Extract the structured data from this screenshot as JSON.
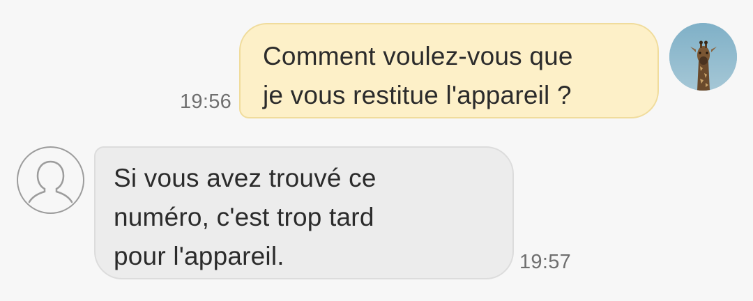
{
  "conversation": {
    "messages": [
      {
        "direction": "outgoing",
        "text": "Comment voulez-vous que\nje vous restitue l'appareil ?",
        "time": "19:56",
        "avatar_icon": "giraffe-photo-avatar"
      },
      {
        "direction": "incoming",
        "text": "Si vous avez trouvé ce\nnuméro, c'est trop tard\npour l'appareil.",
        "time": "19:57",
        "avatar_icon": "default-person-icon"
      }
    ]
  },
  "colors": {
    "background": "#f7f7f7",
    "outgoing_bubble": "#fdf0c8",
    "outgoing_border": "#f0dc9c",
    "incoming_bubble": "#ececec",
    "incoming_border": "#dcdcdc",
    "text": "#2b2b2b",
    "timestamp": "#6f6f6f"
  }
}
